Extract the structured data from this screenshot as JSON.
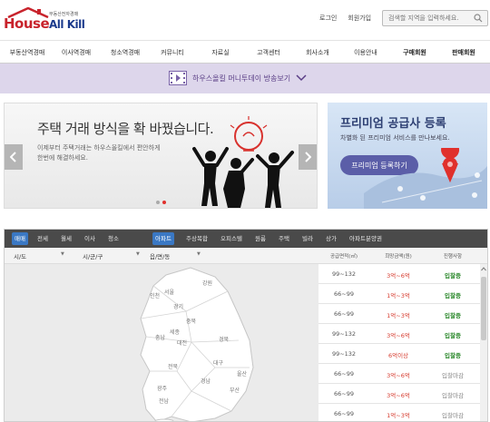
{
  "logo": {
    "house": "House",
    "allkill": "All Kill",
    "tagline": "부동산전자경매"
  },
  "top_links": {
    "login": "로그인",
    "signup": "회원가입"
  },
  "search": {
    "placeholder": "검색할 지역을 입력하세요."
  },
  "nav": {
    "items": [
      {
        "label": "부동산역경매",
        "bold": false
      },
      {
        "label": "이사역경매",
        "bold": false
      },
      {
        "label": "청소역경매",
        "bold": false
      },
      {
        "label": "커뮤니티",
        "bold": false
      },
      {
        "label": "자료실",
        "bold": false
      },
      {
        "label": "고객센터",
        "bold": false
      },
      {
        "label": "회사소개",
        "bold": false
      },
      {
        "label": "이용안내",
        "bold": false
      },
      {
        "label": "구매회원",
        "bold": true
      },
      {
        "label": "판매회원",
        "bold": true
      }
    ]
  },
  "promo": {
    "text": "하우스올킬 머니투데이 방송보기"
  },
  "banner": {
    "title": "주택 거래 방식을 확 바꿨습니다.",
    "subtitle": "이제부터 주택거래는 하우스올킬에서 편안하게 한번에 해결하세요."
  },
  "premium": {
    "title": "프리미엄 공급사 등록",
    "subtitle": "차별화 된 프리미엄 서비스를 만나보세요.",
    "button": "프리미엄 등록하기"
  },
  "listing": {
    "type_tabs": [
      {
        "label": "매매",
        "active": true
      },
      {
        "label": "전세",
        "active": false
      },
      {
        "label": "월세",
        "active": false
      },
      {
        "label": "이사",
        "active": false
      },
      {
        "label": "청소",
        "active": false
      },
      {
        "label": "아파트",
        "active": true
      },
      {
        "label": "주상복합",
        "active": false
      },
      {
        "label": "오피스텔",
        "active": false
      },
      {
        "label": "원룸",
        "active": false
      },
      {
        "label": "주택",
        "active": false
      },
      {
        "label": "빌라",
        "active": false
      },
      {
        "label": "상가",
        "active": false
      },
      {
        "label": "아파트분양권",
        "active": false
      }
    ],
    "filters": {
      "sido": "시/도",
      "sigungu": "시/군/구",
      "eupmyeondong": "읍/면/동"
    },
    "columns": {
      "area": "공급면적(㎡)",
      "price": "희망금액(원)",
      "status": "진행사항"
    },
    "rows": [
      {
        "area": "99~132",
        "price": "3억~6억",
        "status": "입찰중",
        "closed": false
      },
      {
        "area": "66~99",
        "price": "1억~3억",
        "status": "입찰중",
        "closed": false
      },
      {
        "area": "66~99",
        "price": "1억~3억",
        "status": "입찰중",
        "closed": false
      },
      {
        "area": "99~132",
        "price": "3억~6억",
        "status": "입찰중",
        "closed": false
      },
      {
        "area": "99~132",
        "price": "6억이상",
        "status": "입찰중",
        "closed": false
      },
      {
        "area": "66~99",
        "price": "3억~6억",
        "status": "입찰마감",
        "closed": true
      },
      {
        "area": "66~99",
        "price": "3억~6억",
        "status": "입찰마감",
        "closed": true
      },
      {
        "area": "66~99",
        "price": "1억~3억",
        "status": "입찰마감",
        "closed": true
      }
    ],
    "map_regions": [
      "강원",
      "인천",
      "서울",
      "경기",
      "충북",
      "세종",
      "충남",
      "대전",
      "경북",
      "전북",
      "대구",
      "울산",
      "경남",
      "부산",
      "광주",
      "전남"
    ]
  },
  "colors": {
    "brand_red": "#c8232c",
    "brand_blue": "#1b3a8c",
    "promo_bg": "#ddd6eb",
    "active_tab": "#3a78c4",
    "bid_open": "#2e8a2e",
    "price_red": "#d6392c"
  }
}
